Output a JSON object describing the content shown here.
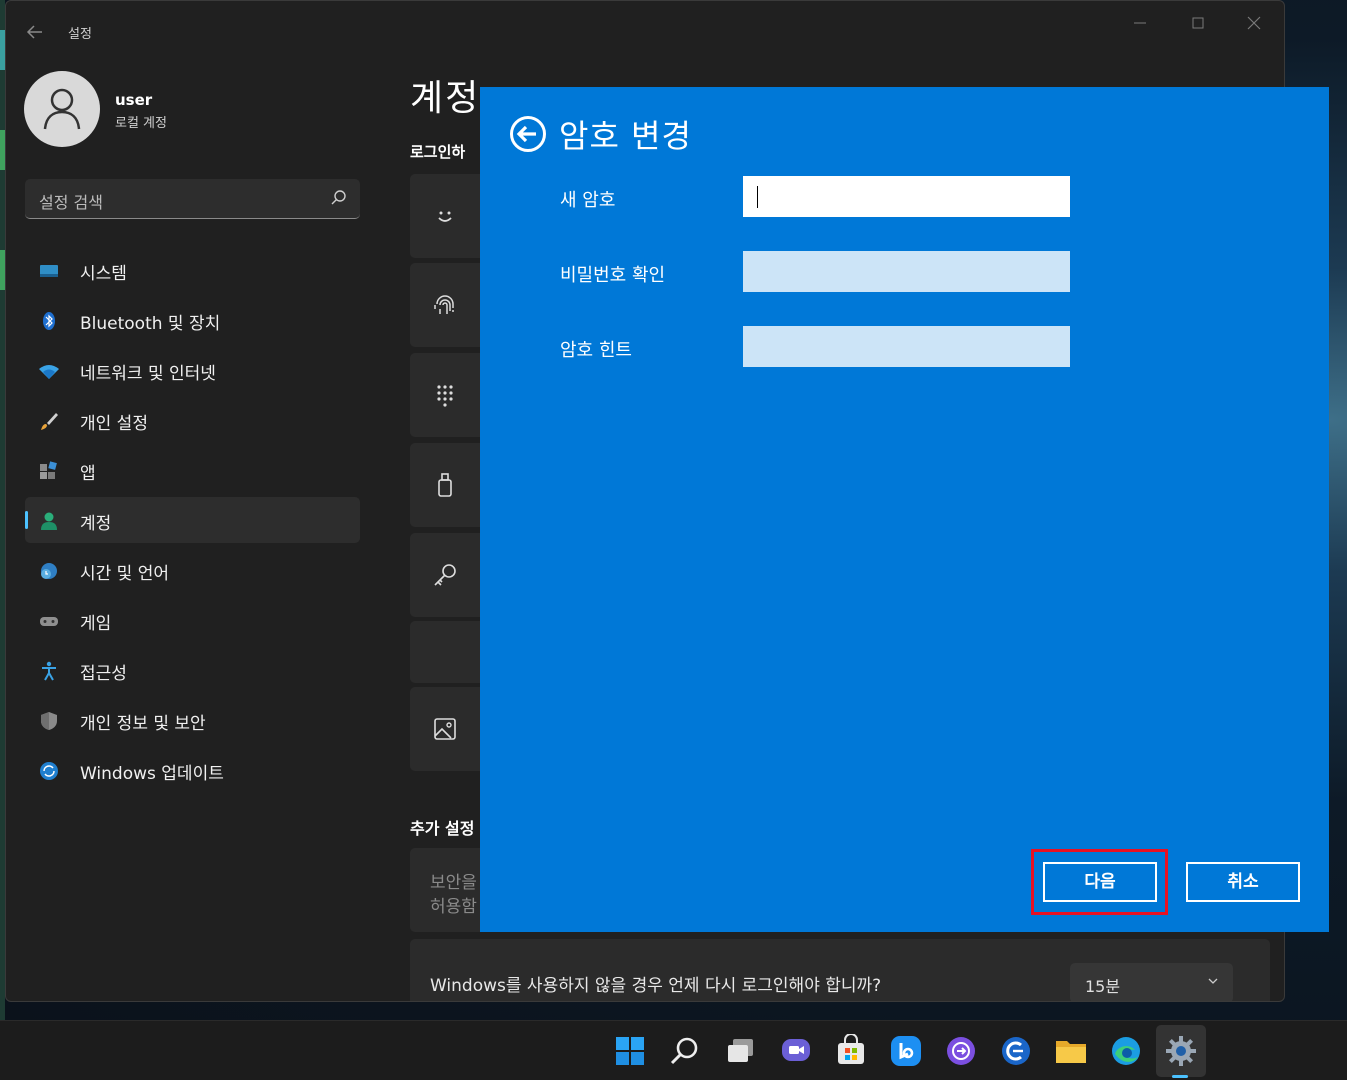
{
  "window": {
    "title": "설정",
    "back_icon": "back-arrow-icon",
    "controls": [
      "minimize-icon",
      "maximize-icon",
      "close-icon"
    ]
  },
  "profile": {
    "name": "user",
    "account_type": "로컬 계정"
  },
  "search": {
    "placeholder": "설정 검색"
  },
  "nav": {
    "items": [
      {
        "label": "시스템",
        "icon": "system-icon"
      },
      {
        "label": "Bluetooth 및 장치",
        "icon": "bluetooth-icon"
      },
      {
        "label": "네트워크 및 인터넷",
        "icon": "wifi-icon"
      },
      {
        "label": "개인 설정",
        "icon": "brush-icon"
      },
      {
        "label": "앱",
        "icon": "apps-icon"
      },
      {
        "label": "계정",
        "icon": "account-icon",
        "active": true
      },
      {
        "label": "시간 및 언어",
        "icon": "time-language-icon"
      },
      {
        "label": "게임",
        "icon": "gaming-icon"
      },
      {
        "label": "접근성",
        "icon": "accessibility-icon"
      },
      {
        "label": "개인 정보 및 보안",
        "icon": "shield-icon"
      },
      {
        "label": "Windows 업데이트",
        "icon": "update-icon"
      }
    ]
  },
  "main": {
    "title": "계정",
    "section_label": "로그인하",
    "section2_label": "추가 설정",
    "cards": [
      "face-icon",
      "fingerprint-icon",
      "pin-icon",
      "security-key-icon",
      "key-icon",
      "blank",
      "picture-password-icon"
    ],
    "extra_line1": "보안을",
    "extra_line2": "허용함",
    "timeout_question": "Windows를 사용하지 않을 경우 언제 다시 로그인해야 합니까?",
    "timeout_value": "15분"
  },
  "dialog": {
    "title": "암호 변경",
    "fields": [
      {
        "label": "새 암호",
        "value": ""
      },
      {
        "label": "비밀번호 확인",
        "value": ""
      },
      {
        "label": "암호 힌트",
        "value": ""
      }
    ],
    "next_label": "다음",
    "cancel_label": "취소",
    "highlight_color": "#e81123",
    "background_color": "#0078d7"
  },
  "taskbar": {
    "icons": [
      "start-icon",
      "search-icon",
      "task-view-icon",
      "chat-icon",
      "store-icon",
      "bing-icon",
      "app-icon",
      "app2-icon",
      "file-explorer-icon",
      "edge-icon",
      "settings-icon"
    ]
  }
}
